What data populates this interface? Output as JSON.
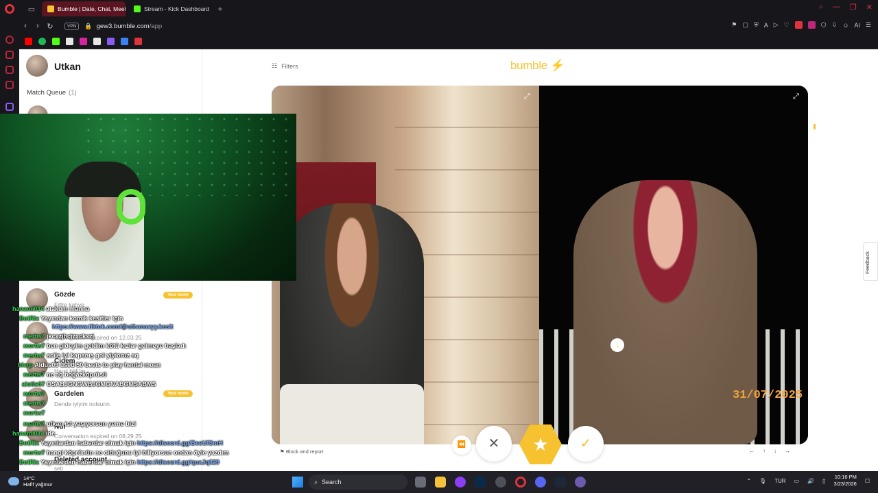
{
  "browser": {
    "tabs": [
      {
        "title": "Bumble | Date, Chat, Meet",
        "active": true
      },
      {
        "title": "Stream - Kick Dashboard",
        "active": false
      }
    ],
    "vpn_label": "VPN",
    "url_host": "gew3.bumble.com",
    "url_path": "/app",
    "ai_label": "AI"
  },
  "sidebar": {
    "username": "Utkan",
    "match_queue_label": "Match Queue",
    "match_queue_count": "(1)",
    "conversations": [
      {
        "name": "Gözde",
        "sub": "Filtre kahve",
        "badge": "Your move"
      },
      {
        "name": "...",
        "sub": "Conversation expired on 12.03.25",
        "badge": ""
      },
      {
        "name": "Çidem",
        "sub": "Harçi bölüm",
        "badge": ""
      },
      {
        "name": "Gardelen",
        "sub": "Dende iyiyim nolsunn",
        "badge": "Your move"
      },
      {
        "name": "Nur",
        "sub": "Conversation expired on 08.29.25",
        "badge": ""
      }
    ],
    "deleted_name": "Deleted account",
    "deleted_sub": "seb"
  },
  "main": {
    "filters_label": "Filters",
    "logo": "bumble",
    "photo_datestamp": "31/07/2025",
    "block_report": "Block and report",
    "pager": [
      "←",
      "↑",
      "↓",
      "→"
    ],
    "feedback": "Feedback"
  },
  "chat": [
    {
      "user": "hanami014",
      "msg": "atakum manna"
    },
    {
      "user": "BotRix",
      "msg": "Yayından komik kesitler için ",
      "link": "https://www.tiktok.com/@uthanaxyy.kesit"
    },
    {
      "user": "mertw7",
      "msg": "jkcxzjhcjzxckxzj"
    },
    {
      "user": "mertw7",
      "msg": "ben gideyim geldim kötü kızlar gelmeye başladı"
    },
    {
      "user": "mertw7",
      "msg": "acile iyi kapanış gol yiyioruz aq"
    },
    {
      "user": "bierp",
      "msg": "Aldus09 used 50 beets to play hentai moan"
    },
    {
      "user": "mertw7",
      "msg": "ne aq boğazköprüsü"
    },
    {
      "user": "alotis67",
      "msg": "OSABJGNGWBJGMGNABGMSABMS"
    },
    {
      "user": "mertw7",
      "msg": ""
    },
    {
      "user": "mertw7",
      "msg": ""
    },
    {
      "user": "mertw7",
      "msg": ""
    },
    {
      "user": "mertw7",
      "msg": "utkan ist yaşıyorsun yeme bizi"
    },
    {
      "user": "hanami014",
      "msg": "ide"
    },
    {
      "user": "BotRix",
      "msg": "Yayınlardan haberdar olmak için ",
      "link": "https://discord.gg/BeeUfSmH"
    },
    {
      "user": "mertw7",
      "msg": "hangi köprünün ne olduğunu iyi biliyorsun ondan öyle yazdım"
    },
    {
      "user": "BotRix",
      "msg": "Yayınlardan haberdar olmak için ",
      "link": "https://discord.gg/quaJq829"
    }
  ],
  "taskbar": {
    "temp": "14°C",
    "weather": "Hafif yağmur",
    "search_label": "Search",
    "lang": "TUR",
    "time": "10:16 PM",
    "date": "3/23/2026"
  },
  "colors": {
    "bumble_yellow": "#f6c230",
    "opera_red": "#e0343c",
    "chat_user_green": "#39d353",
    "link_blue": "#7fb4ff"
  }
}
